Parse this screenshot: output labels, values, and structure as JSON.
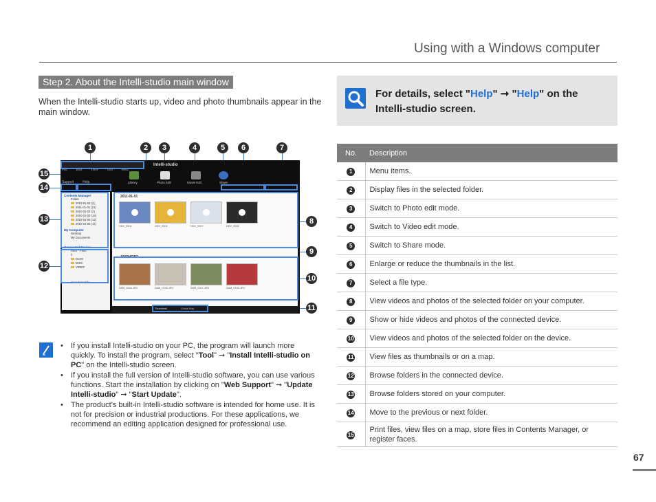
{
  "header": {
    "title": "Using with a Windows computer"
  },
  "step": {
    "heading": "Step 2. About the Intelli-studio main window",
    "intro": "When the Intelli-studio starts up, video and photo thumbnails appear in the main window."
  },
  "tip": {
    "prefix": "For details, select \"",
    "help1": "Help",
    "middle": "\" ➞ \"",
    "help2": "Help",
    "suffix": "\" on the Intelli-studio screen.",
    "icon": "magnifier-icon"
  },
  "figure": {
    "menu_items": [
      "File",
      "Edit",
      "View",
      "Tool",
      "Web Support",
      "Help"
    ],
    "brand": "Intelli-studio",
    "modes": [
      "Library",
      "Photo Edit",
      "Movie Edit",
      "Share"
    ],
    "left_pane": {
      "contents_manager": "Contents Manager",
      "folder": "Folder",
      "dates": [
        {
          "date": "2010-01-04",
          "count": "(2)"
        },
        {
          "date": "2011-01-01",
          "count": "(21)"
        },
        {
          "date": "2010-01-02",
          "count": "(2)"
        },
        {
          "date": "2010-01-03",
          "count": "(13)"
        },
        {
          "date": "2010-01-05",
          "count": "(12)"
        },
        {
          "date": "2010-01-06",
          "count": "(11)"
        }
      ],
      "my_computer": "My Computer",
      "desktop": "Desktop",
      "my_documents": "My Documents",
      "connected_device": "Connected Device",
      "device": "HMX - F800",
      "drive": "\\\\",
      "device_folders": [
        "DCIM",
        "MISC",
        "VIDEO"
      ],
      "save_new_file": "Save New File"
    },
    "main_pane": {
      "folder_date": "2011-01-01",
      "top_labels": [
        "HDV_0001",
        "HDV_0004",
        "HDV_0007",
        "HDV_0006"
      ],
      "device_folder": "100PHOTO",
      "bottom_labels": [
        "SAM_0094.JPG",
        "SAM_0105.JPG",
        "SAM_0017.JPG",
        "SAM_0105.JPG"
      ]
    },
    "bottom_tabs": [
      "Thumbnail",
      "Global Map"
    ]
  },
  "table": {
    "header_no": "No.",
    "header_desc": "Description",
    "rows": [
      {
        "no": "1",
        "desc": "Menu items."
      },
      {
        "no": "2",
        "desc": "Display files in the selected folder."
      },
      {
        "no": "3",
        "desc": "Switch to Photo edit mode."
      },
      {
        "no": "4",
        "desc": "Switch to Video edit mode."
      },
      {
        "no": "5",
        "desc": "Switch to Share mode."
      },
      {
        "no": "6",
        "desc": "Enlarge or reduce the thumbnails in the list."
      },
      {
        "no": "7",
        "desc": "Select a file type."
      },
      {
        "no": "8",
        "desc": "View videos and photos of the selected folder on your computer."
      },
      {
        "no": "9",
        "desc": "Show or hide videos and photos of the connected device."
      },
      {
        "no": "10",
        "desc": "View videos and photos of the selected folder on the device."
      },
      {
        "no": "11",
        "desc": "View files as thumbnails or on a map."
      },
      {
        "no": "12",
        "desc": "Browse folders in the connected device."
      },
      {
        "no": "13",
        "desc": "Browse folders stored on your computer."
      },
      {
        "no": "14",
        "desc": "Move to the previous or next folder."
      },
      {
        "no": "15",
        "desc": "Print files, view files on a map, store files in Contents Manager, or register faces."
      }
    ]
  },
  "notes": {
    "icon": "pencil-note-icon",
    "n1_a": "If you install Intelli-studio on your PC, the program will launch more quickly. To install the program, select \"",
    "n1_tool": "Tool",
    "n1_b": "\" ➞ \"",
    "n1_install": "Install Intelli-studio on PC",
    "n1_c": "\" on the Intelli-studio screen.",
    "n2_a": "If you install the full version of Intelli-studio software, you can use various functions. Start the installation by clicking on \"",
    "n2_web": "Web Support",
    "n2_b": "\" ➞ \"",
    "n2_update": "Update Intelli-studio",
    "n2_c": "\" ➞ \"",
    "n2_start": "Start Update",
    "n2_d": "\".",
    "n3": "The product's built-in Intelli-studio software is intended for home use. It is not for precision or industrial productions. For these applications, we recommend an editing application designed for professional use."
  },
  "page": {
    "number": "67"
  }
}
